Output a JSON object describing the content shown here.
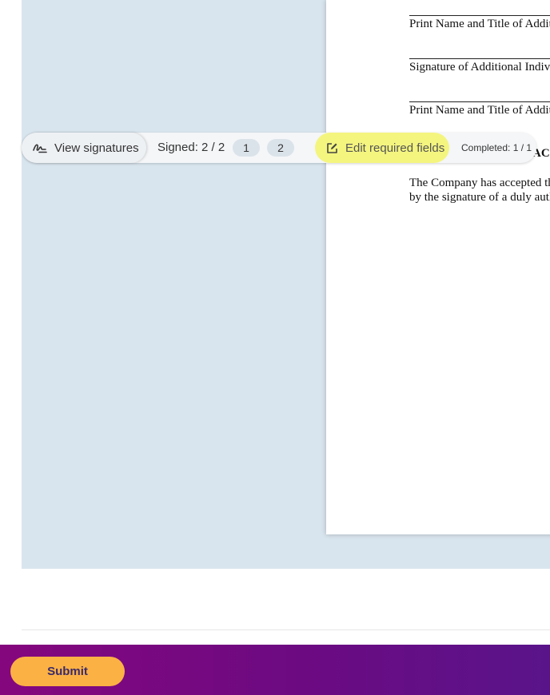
{
  "document": {
    "line1_text": "Print Name and Title of Additional Individual",
    "line2_text": "Signature of Additional Individual",
    "line3_text": "Print Name and Title of Additional Individual",
    "heading": "ACCEPTANCE",
    "para_line1": "The Company has accepted the foregoing",
    "para_line2": "by the signature of a duly authorized officer"
  },
  "toolbar": {
    "view_signatures_label": "View signatures",
    "signed_label": "Signed: 2 / 2",
    "signer_pages": [
      "1",
      "2"
    ],
    "edit_fields_label": "Edit required fields",
    "completed_label": "Completed: 1 / 1",
    "edit_highlight_color": "#f4f57f"
  },
  "footer": {
    "submit_label": "Submit",
    "submit_color": "#fbb144",
    "bar_color": "#7a0a80"
  }
}
